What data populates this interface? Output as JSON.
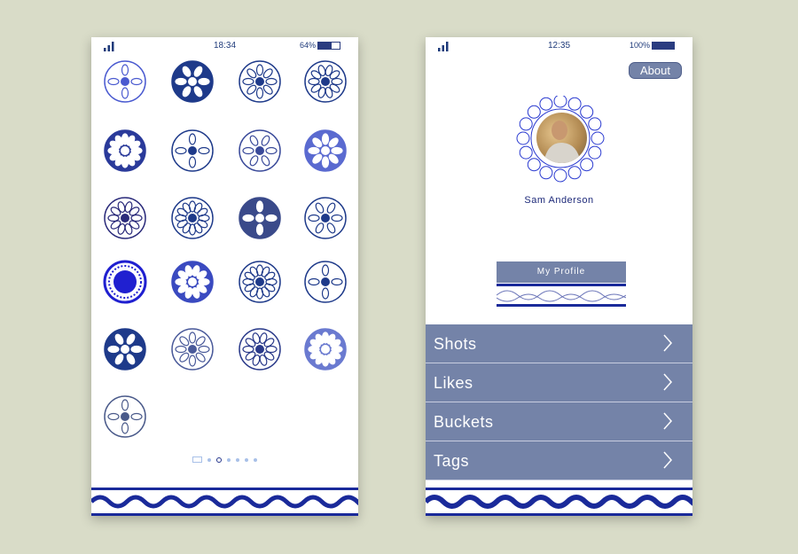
{
  "home": {
    "status": {
      "time": "18:34",
      "battery": "64%",
      "battery_level": 0.64
    },
    "medallion_count": 21,
    "pagination": {
      "pages": 7,
      "active": 2
    },
    "colors": {
      "accent": "#1e3a9a",
      "light": "#4a5ad0"
    }
  },
  "profile": {
    "status": {
      "time": "12:35",
      "battery": "100%",
      "battery_level": 1.0
    },
    "about_label": "About",
    "user_name": "Sam Anderson",
    "my_profile_label": "My  Profile",
    "menu": [
      {
        "label": "Shots",
        "icon": "chevron-right-icon"
      },
      {
        "label": "Likes",
        "icon": "chevron-right-icon"
      },
      {
        "label": "Buckets",
        "icon": "chevron-right-icon"
      },
      {
        "label": "Tags",
        "icon": "chevron-right-icon"
      }
    ],
    "colors": {
      "menu": "#7483a8",
      "text": "#1e2a7a"
    }
  }
}
